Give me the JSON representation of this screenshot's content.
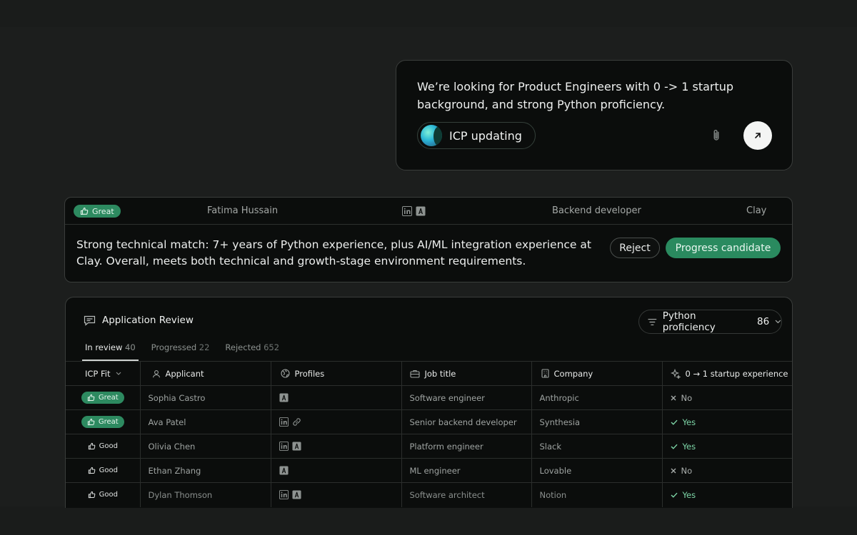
{
  "prompt": {
    "text": "We’re looking for Product Engineers with 0 -> 1 startup background, and strong Python proficiency.",
    "icp_status": "ICP updating",
    "attach_icon": "paperclip-icon",
    "send_icon": "arrow-up-right-icon"
  },
  "candidate": {
    "fit": "Great",
    "name": "Fatima Hussain",
    "profiles": [
      "linkedin-icon",
      "anthropic-icon"
    ],
    "job_title": "Backend developer",
    "company": "Clay",
    "summary": "Strong technical match: 7+ years of Python experience, plus AI/ML integration experience at Clay. Overall, meets both technical and growth-stage environment requirements.",
    "reject_label": "Reject",
    "progress_label": "Progress candidate"
  },
  "review": {
    "title": "Application Review",
    "filter": {
      "label": "Python proficiency",
      "count": "86"
    },
    "tabs": [
      {
        "label": "In review",
        "count": "40",
        "active": true
      },
      {
        "label": "Progressed",
        "count": "22"
      },
      {
        "label": "Rejected",
        "count": "652"
      }
    ],
    "columns": {
      "fit": "ICP Fit",
      "applicant": "Applicant",
      "profiles": "Profiles",
      "job": "Job title",
      "company": "Company",
      "startup": "0 → 1 startup experience"
    },
    "rows": [
      {
        "fit": "Great",
        "applicant": "Sophia Castro",
        "profiles": [
          "anthropic-icon"
        ],
        "job": "Software engineer",
        "company": "Anthropic",
        "startup": "No"
      },
      {
        "fit": "Great",
        "applicant": "Ava Patel",
        "profiles": [
          "linkedin-icon",
          "link-icon"
        ],
        "job": "Senior backend developer",
        "company": "Synthesia",
        "startup": "Yes"
      },
      {
        "fit": "Good",
        "applicant": "Olivia Chen",
        "profiles": [
          "linkedin-icon",
          "anthropic-icon"
        ],
        "job": "Platform engineer",
        "company": "Slack",
        "startup": "Yes"
      },
      {
        "fit": "Good",
        "applicant": "Ethan Zhang",
        "profiles": [
          "anthropic-icon"
        ],
        "job": "ML engineer",
        "company": "Lovable",
        "startup": "No"
      },
      {
        "fit": "Good",
        "applicant": "Dylan Thomson",
        "profiles": [
          "linkedin-icon",
          "anthropic-icon"
        ],
        "job": "Software architect",
        "company": "Notion",
        "startup": "Yes"
      }
    ]
  },
  "colors": {
    "accent": "#2d8a60",
    "yes": "#7ed7a8",
    "background": "#1c1e1d",
    "card": "#0b0d0c"
  }
}
